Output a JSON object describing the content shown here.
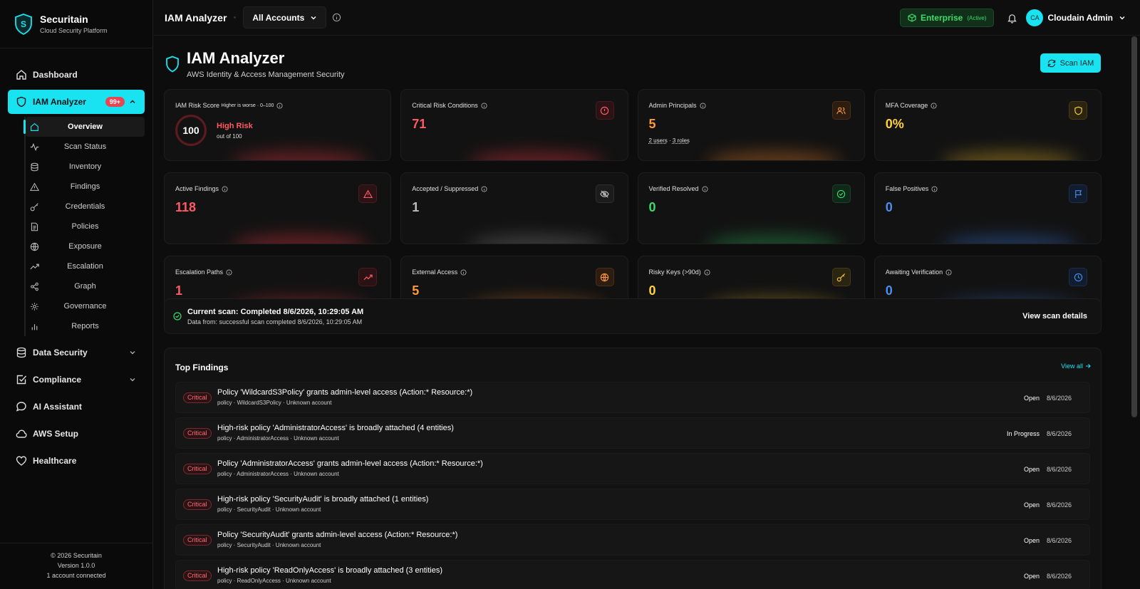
{
  "brand": {
    "name": "Securitain",
    "tagline": "Cloud Security Platform"
  },
  "sidebar": {
    "items": [
      {
        "label": "Dashboard"
      },
      {
        "label": "IAM Analyzer",
        "badge": "99+"
      },
      {
        "label": "Data Security"
      },
      {
        "label": "Compliance"
      },
      {
        "label": "AI Assistant"
      },
      {
        "label": "AWS Setup"
      },
      {
        "label": "Healthcare"
      }
    ],
    "sub_items": [
      {
        "label": "Overview"
      },
      {
        "label": "Scan Status"
      },
      {
        "label": "Inventory"
      },
      {
        "label": "Findings"
      },
      {
        "label": "Credentials"
      },
      {
        "label": "Policies"
      },
      {
        "label": "Exposure"
      },
      {
        "label": "Escalation"
      },
      {
        "label": "Graph"
      },
      {
        "label": "Governance"
      },
      {
        "label": "Reports"
      }
    ],
    "footer": {
      "copyright": "© 2026 Securitain",
      "version": "Version 1.0.0",
      "accounts": "1 account connected"
    }
  },
  "topbar": {
    "title": "IAM Analyzer",
    "account_select": "All Accounts",
    "plan": "Enterprise",
    "plan_status": "(Active)",
    "user_initials": "CA",
    "user_name": "Cloudain Admin"
  },
  "page": {
    "title": "IAM Analyzer",
    "subtitle": "AWS Identity & Access Management Security",
    "scan_button": "Scan IAM"
  },
  "colors": {
    "accent": "#19e3f0",
    "critical": "#ff5a64",
    "orange": "#ff9a3c",
    "yellow": "#ffd23c",
    "green": "#3ddc6a",
    "blue": "#4a8ff0"
  },
  "cards": {
    "risk": {
      "title": "IAM Risk Score",
      "hint": "Higher is worse · 0–100",
      "value": "100",
      "level": "High Risk",
      "out_of": "out of 100"
    },
    "critical_conditions": {
      "title": "Critical Risk Conditions",
      "value": "71"
    },
    "admin_principals": {
      "title": "Admin Principals",
      "value": "5",
      "users": "2 users",
      "sep": "·",
      "roles": "3 roles"
    },
    "mfa": {
      "title": "MFA Coverage",
      "value": "0%"
    },
    "active_findings": {
      "title": "Active Findings",
      "value": "118"
    },
    "accepted": {
      "title": "Accepted / Suppressed",
      "value": "1"
    },
    "verified": {
      "title": "Verified Resolved",
      "value": "0"
    },
    "false_pos": {
      "title": "False Positives",
      "value": "0"
    },
    "escalation": {
      "title": "Escalation Paths",
      "value": "1"
    },
    "external": {
      "title": "External Access",
      "value": "5"
    },
    "risky_keys": {
      "title": "Risky Keys (>90d)",
      "value": "0"
    },
    "awaiting": {
      "title": "Awaiting Verification",
      "value": "0"
    }
  },
  "scan": {
    "status": "Current scan: Completed 8/6/2026, 10:29:05 AM",
    "source": "Data from: successful scan completed 8/6/2026, 10:29:05 AM",
    "details_link": "View scan details"
  },
  "findings": {
    "title": "Top Findings",
    "view_all": "View all",
    "rows": [
      {
        "severity": "Critical",
        "title": "Policy 'WildcardS3Policy' grants admin-level access (Action:* Resource:*)",
        "sub": "policy · WildcardS3Policy · Unknown account",
        "status": "Open",
        "date": "8/6/2026"
      },
      {
        "severity": "Critical",
        "title": "High-risk policy 'AdministratorAccess' is broadly attached (4 entities)",
        "sub": "policy · AdministratorAccess · Unknown account",
        "status": "In Progress",
        "date": "8/6/2026"
      },
      {
        "severity": "Critical",
        "title": "Policy 'AdministratorAccess' grants admin-level access (Action:* Resource:*)",
        "sub": "policy · AdministratorAccess · Unknown account",
        "status": "Open",
        "date": "8/6/2026"
      },
      {
        "severity": "Critical",
        "title": "High-risk policy 'SecurityAudit' is broadly attached (1 entities)",
        "sub": "policy · SecurityAudit · Unknown account",
        "status": "Open",
        "date": "8/6/2026"
      },
      {
        "severity": "Critical",
        "title": "Policy 'SecurityAudit' grants admin-level access (Action:* Resource:*)",
        "sub": "policy · SecurityAudit · Unknown account",
        "status": "Open",
        "date": "8/6/2026"
      },
      {
        "severity": "Critical",
        "title": "High-risk policy 'ReadOnlyAccess' is broadly attached (3 entities)",
        "sub": "policy · ReadOnlyAccess · Unknown account",
        "status": "Open",
        "date": "8/6/2026"
      }
    ]
  }
}
